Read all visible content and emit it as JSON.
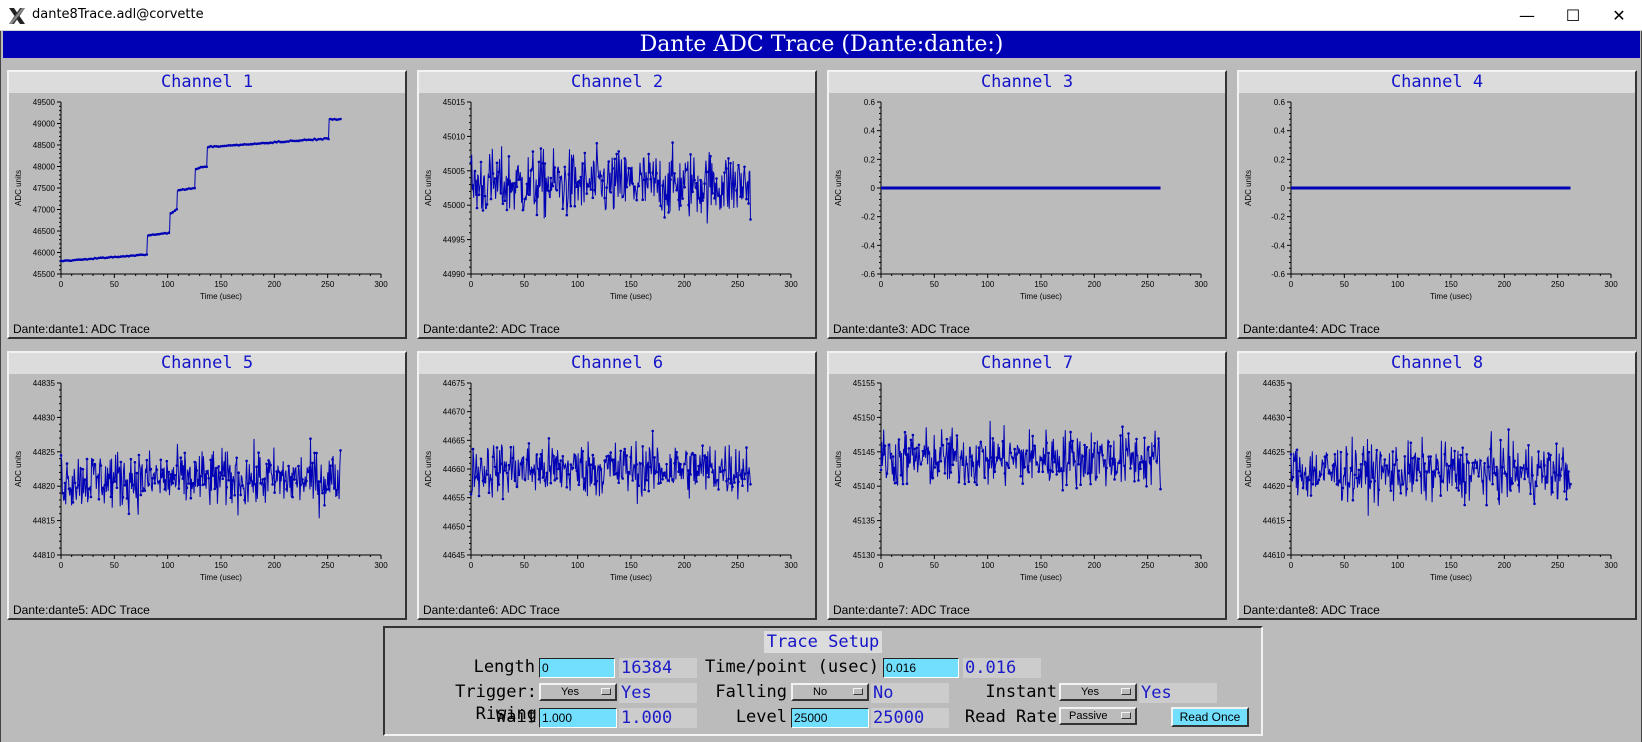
{
  "window": {
    "title": "dante8Trace.adl@corvette",
    "minimize": "—",
    "maximize": "☐",
    "close": "✕"
  },
  "banner": "Dante ADC Trace (Dante:dante:)",
  "axes_common": {
    "xlabel": "Time (usec)",
    "ylabel": "ADC units",
    "xticks": [
      "0",
      "50",
      "100",
      "150",
      "200",
      "250",
      "300"
    ]
  },
  "channels": [
    {
      "title": "Channel 1",
      "footer": "Dante:dante1: ADC Trace",
      "yticks": [
        "45500",
        "46000",
        "46500",
        "47000",
        "47500",
        "48000",
        "48500",
        "49000",
        "49500"
      ]
    },
    {
      "title": "Channel 2",
      "footer": "Dante:dante2: ADC Trace",
      "yticks": [
        "44990",
        "44995",
        "45000",
        "45005",
        "45010",
        "45015"
      ]
    },
    {
      "title": "Channel 3",
      "footer": "Dante:dante3: ADC Trace",
      "yticks": [
        "-0.6",
        "-0.4",
        "-0.2",
        "0",
        "0.2",
        "0.4",
        "0.6"
      ]
    },
    {
      "title": "Channel 4",
      "footer": "Dante:dante4: ADC Trace",
      "yticks": [
        "-0.6",
        "-0.4",
        "-0.2",
        "0",
        "0.2",
        "0.4",
        "0.6"
      ]
    },
    {
      "title": "Channel 5",
      "footer": "Dante:dante5: ADC Trace",
      "yticks": [
        "44810",
        "44815",
        "44820",
        "44825",
        "44830",
        "44835"
      ]
    },
    {
      "title": "Channel 6",
      "footer": "Dante:dante6: ADC Trace",
      "yticks": [
        "44645",
        "44650",
        "44655",
        "44660",
        "44665",
        "44670",
        "44675"
      ]
    },
    {
      "title": "Channel 7",
      "footer": "Dante:dante7: ADC Trace",
      "yticks": [
        "45130",
        "45135",
        "45140",
        "45145",
        "45150",
        "45155"
      ]
    },
    {
      "title": "Channel 8",
      "footer": "Dante:dante8: ADC Trace",
      "yticks": [
        "44610",
        "44615",
        "44620",
        "44625",
        "44630",
        "44635"
      ]
    }
  ],
  "chart_data": [
    {
      "type": "line",
      "title": "Channel 1",
      "xlabel": "Time (usec)",
      "ylabel": "ADC units",
      "xlim": [
        0,
        300
      ],
      "ylim": [
        45500,
        49500
      ],
      "x_end": 262,
      "steps": [
        [
          0,
          45800
        ],
        [
          80,
          45950
        ],
        [
          82,
          46400
        ],
        [
          100,
          46450
        ],
        [
          103,
          46900
        ],
        [
          108,
          47000
        ],
        [
          110,
          47450
        ],
        [
          125,
          47500
        ],
        [
          127,
          47950
        ],
        [
          135,
          48000
        ],
        [
          138,
          48450
        ],
        [
          248,
          48650
        ],
        [
          252,
          49100
        ],
        [
          262,
          49100
        ]
      ],
      "noise": 20
    },
    {
      "type": "line",
      "title": "Channel 2",
      "xlabel": "Time (usec)",
      "ylabel": "ADC units",
      "xlim": [
        0,
        300
      ],
      "ylim": [
        44990,
        45015
      ],
      "x_end": 262,
      "mean": 45003,
      "noise": 3.5
    },
    {
      "type": "line",
      "title": "Channel 3",
      "xlabel": "Time (usec)",
      "ylabel": "ADC units",
      "xlim": [
        0,
        300
      ],
      "ylim": [
        -0.6,
        0.6
      ],
      "x_end": 262,
      "mean": 0,
      "noise": 0
    },
    {
      "type": "line",
      "title": "Channel 4",
      "xlabel": "Time (usec)",
      "ylabel": "ADC units",
      "xlim": [
        0,
        300
      ],
      "ylim": [
        -0.6,
        0.6
      ],
      "x_end": 262,
      "mean": 0,
      "noise": 0
    },
    {
      "type": "line",
      "title": "Channel 5",
      "xlabel": "Time (usec)",
      "ylabel": "ADC units",
      "xlim": [
        0,
        300
      ],
      "ylim": [
        44810,
        44835
      ],
      "x_end": 262,
      "mean": 44821,
      "noise": 3
    },
    {
      "type": "line",
      "title": "Channel 6",
      "xlabel": "Time (usec)",
      "ylabel": "ADC units",
      "xlim": [
        0,
        300
      ],
      "ylim": [
        44645,
        44675
      ],
      "x_end": 262,
      "mean": 44660,
      "noise": 3.5
    },
    {
      "type": "line",
      "title": "Channel 7",
      "xlabel": "Time (usec)",
      "ylabel": "ADC units",
      "xlim": [
        0,
        300
      ],
      "ylim": [
        45130,
        45155
      ],
      "x_end": 262,
      "mean": 45144,
      "noise": 3
    },
    {
      "type": "line",
      "title": "Channel 8",
      "xlabel": "Time (usec)",
      "ylabel": "ADC units",
      "xlim": [
        0,
        300
      ],
      "ylim": [
        44610,
        44635
      ],
      "x_end": 262,
      "mean": 44622,
      "noise": 3
    }
  ],
  "setup": {
    "title": "Trace Setup",
    "length_label": "Length",
    "length_value": "0",
    "length_readback": "16384",
    "timepoint_label": "Time/point (usec)",
    "timepoint_value": "0.016",
    "timepoint_readback": "0.016",
    "trigger_label": "Trigger: Rising",
    "rising_value": "Yes",
    "rising_readback": "Yes",
    "falling_label": "Falling",
    "falling_value": "No",
    "falling_readback": "No",
    "instant_label": "Instant",
    "instant_value": "Yes",
    "instant_readback": "Yes",
    "wait_label": "Wait",
    "wait_value": "1.000",
    "wait_readback": "1.000",
    "level_label": "Level",
    "level_value": "25000",
    "level_readback": "25000",
    "readrate_label": "Read Rate",
    "readrate_value": "Passive",
    "read_once_label": "Read Once"
  },
  "colors": {
    "banner": "#0000b5",
    "trace": "#0000b5",
    "title_text": "#1414c8",
    "entry_bg": "#73dfff"
  }
}
